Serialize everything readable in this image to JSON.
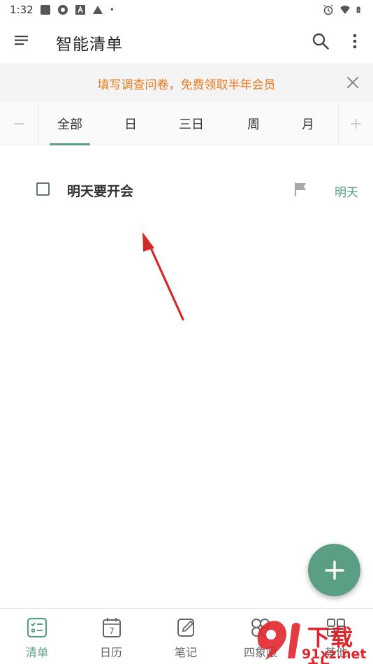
{
  "status_bar": {
    "time": "1:32",
    "dot": "•"
  },
  "app_bar": {
    "title": "智能清单"
  },
  "banner": {
    "text": "填写调查问卷，免费领取半年会员"
  },
  "tabs": {
    "minus_label": "−",
    "plus_label": "+",
    "items": [
      {
        "label": "全部",
        "active": true
      },
      {
        "label": "日",
        "active": false
      },
      {
        "label": "三日",
        "active": false
      },
      {
        "label": "周",
        "active": false
      },
      {
        "label": "月",
        "active": false
      }
    ]
  },
  "tasks": [
    {
      "title": "明天要开会",
      "due": "明天",
      "completed": false
    }
  ],
  "bottom_nav": {
    "items": [
      {
        "label": "清单",
        "icon": "checklist-icon",
        "active": true
      },
      {
        "label": "日历",
        "icon": "calendar-icon",
        "active": false,
        "icon_text": "7"
      },
      {
        "label": "笔记",
        "icon": "note-icon",
        "active": false
      },
      {
        "label": "四象限",
        "icon": "quadrant-icon",
        "active": false
      },
      {
        "label": "其他",
        "icon": "more-grid-icon",
        "active": false
      }
    ]
  },
  "watermark": {
    "top": "下载站",
    "bottom": "91xz.net"
  },
  "colors": {
    "accent": "#5a9e84",
    "banner_text": "#ee7a1e",
    "annotation_arrow": "#d42a2a"
  }
}
